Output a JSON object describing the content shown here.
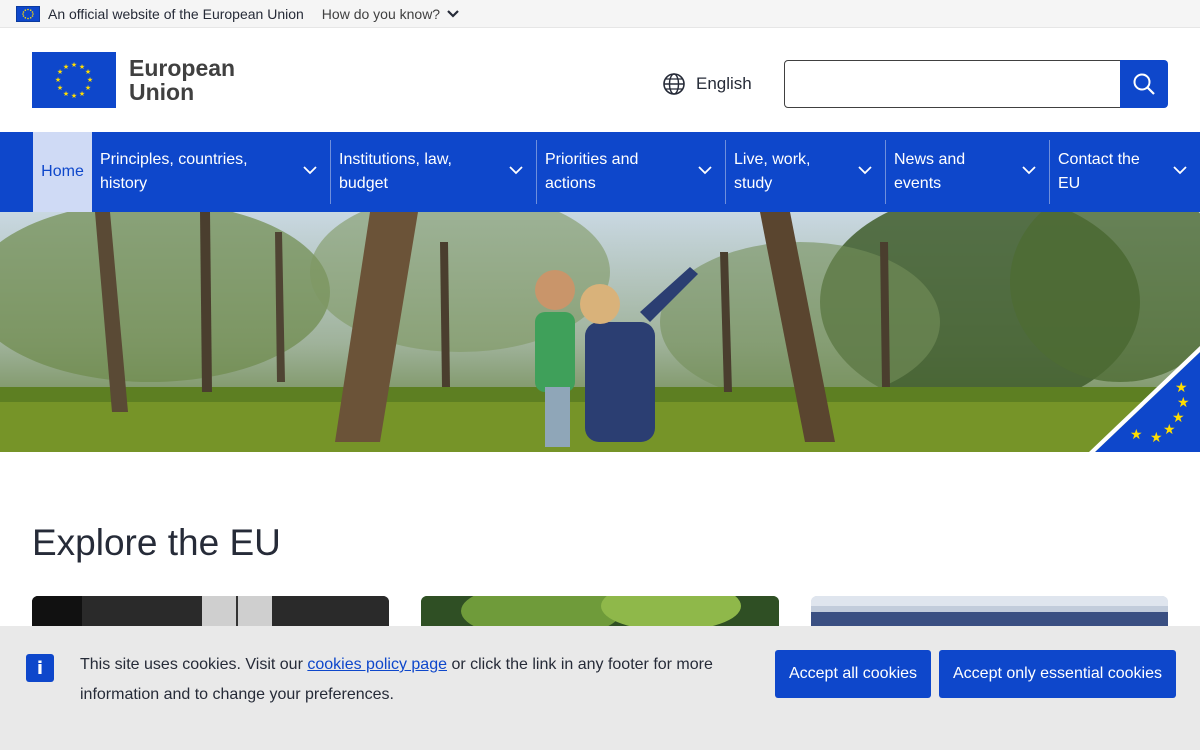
{
  "official_bar": {
    "text": "An official website of the European Union",
    "how_know": "How do you know?"
  },
  "header": {
    "logo_line1": "European",
    "logo_line2": "Union",
    "language": "English",
    "search_placeholder": "",
    "search_icon": "search-icon"
  },
  "nav": {
    "items": [
      {
        "label": "Home"
      },
      {
        "label_l1": "Principles, countries,",
        "label_l2": "history"
      },
      {
        "label_l1": "Institutions, law,",
        "label_l2": "budget"
      },
      {
        "label_l1": "Priorities and",
        "label_l2": "actions"
      },
      {
        "label_l1": "Live, work,",
        "label_l2": "study"
      },
      {
        "label_l1": "News and",
        "label_l2": "events"
      },
      {
        "label_l1": "Contact the",
        "label_l2": "EU"
      }
    ]
  },
  "main": {
    "explore_title": "Explore the EU"
  },
  "cookie": {
    "text_before": "This site uses cookies. Visit our ",
    "link": "cookies policy page",
    "text_after": " or click the link in any footer for more information and to change your preferences.",
    "accept_all": "Accept all cookies",
    "accept_essential": "Accept only essential cookies"
  },
  "colors": {
    "brand_blue": "#0e47cb",
    "home_highlight": "#cfdaf5",
    "banner_bg": "#e9e9e9"
  }
}
